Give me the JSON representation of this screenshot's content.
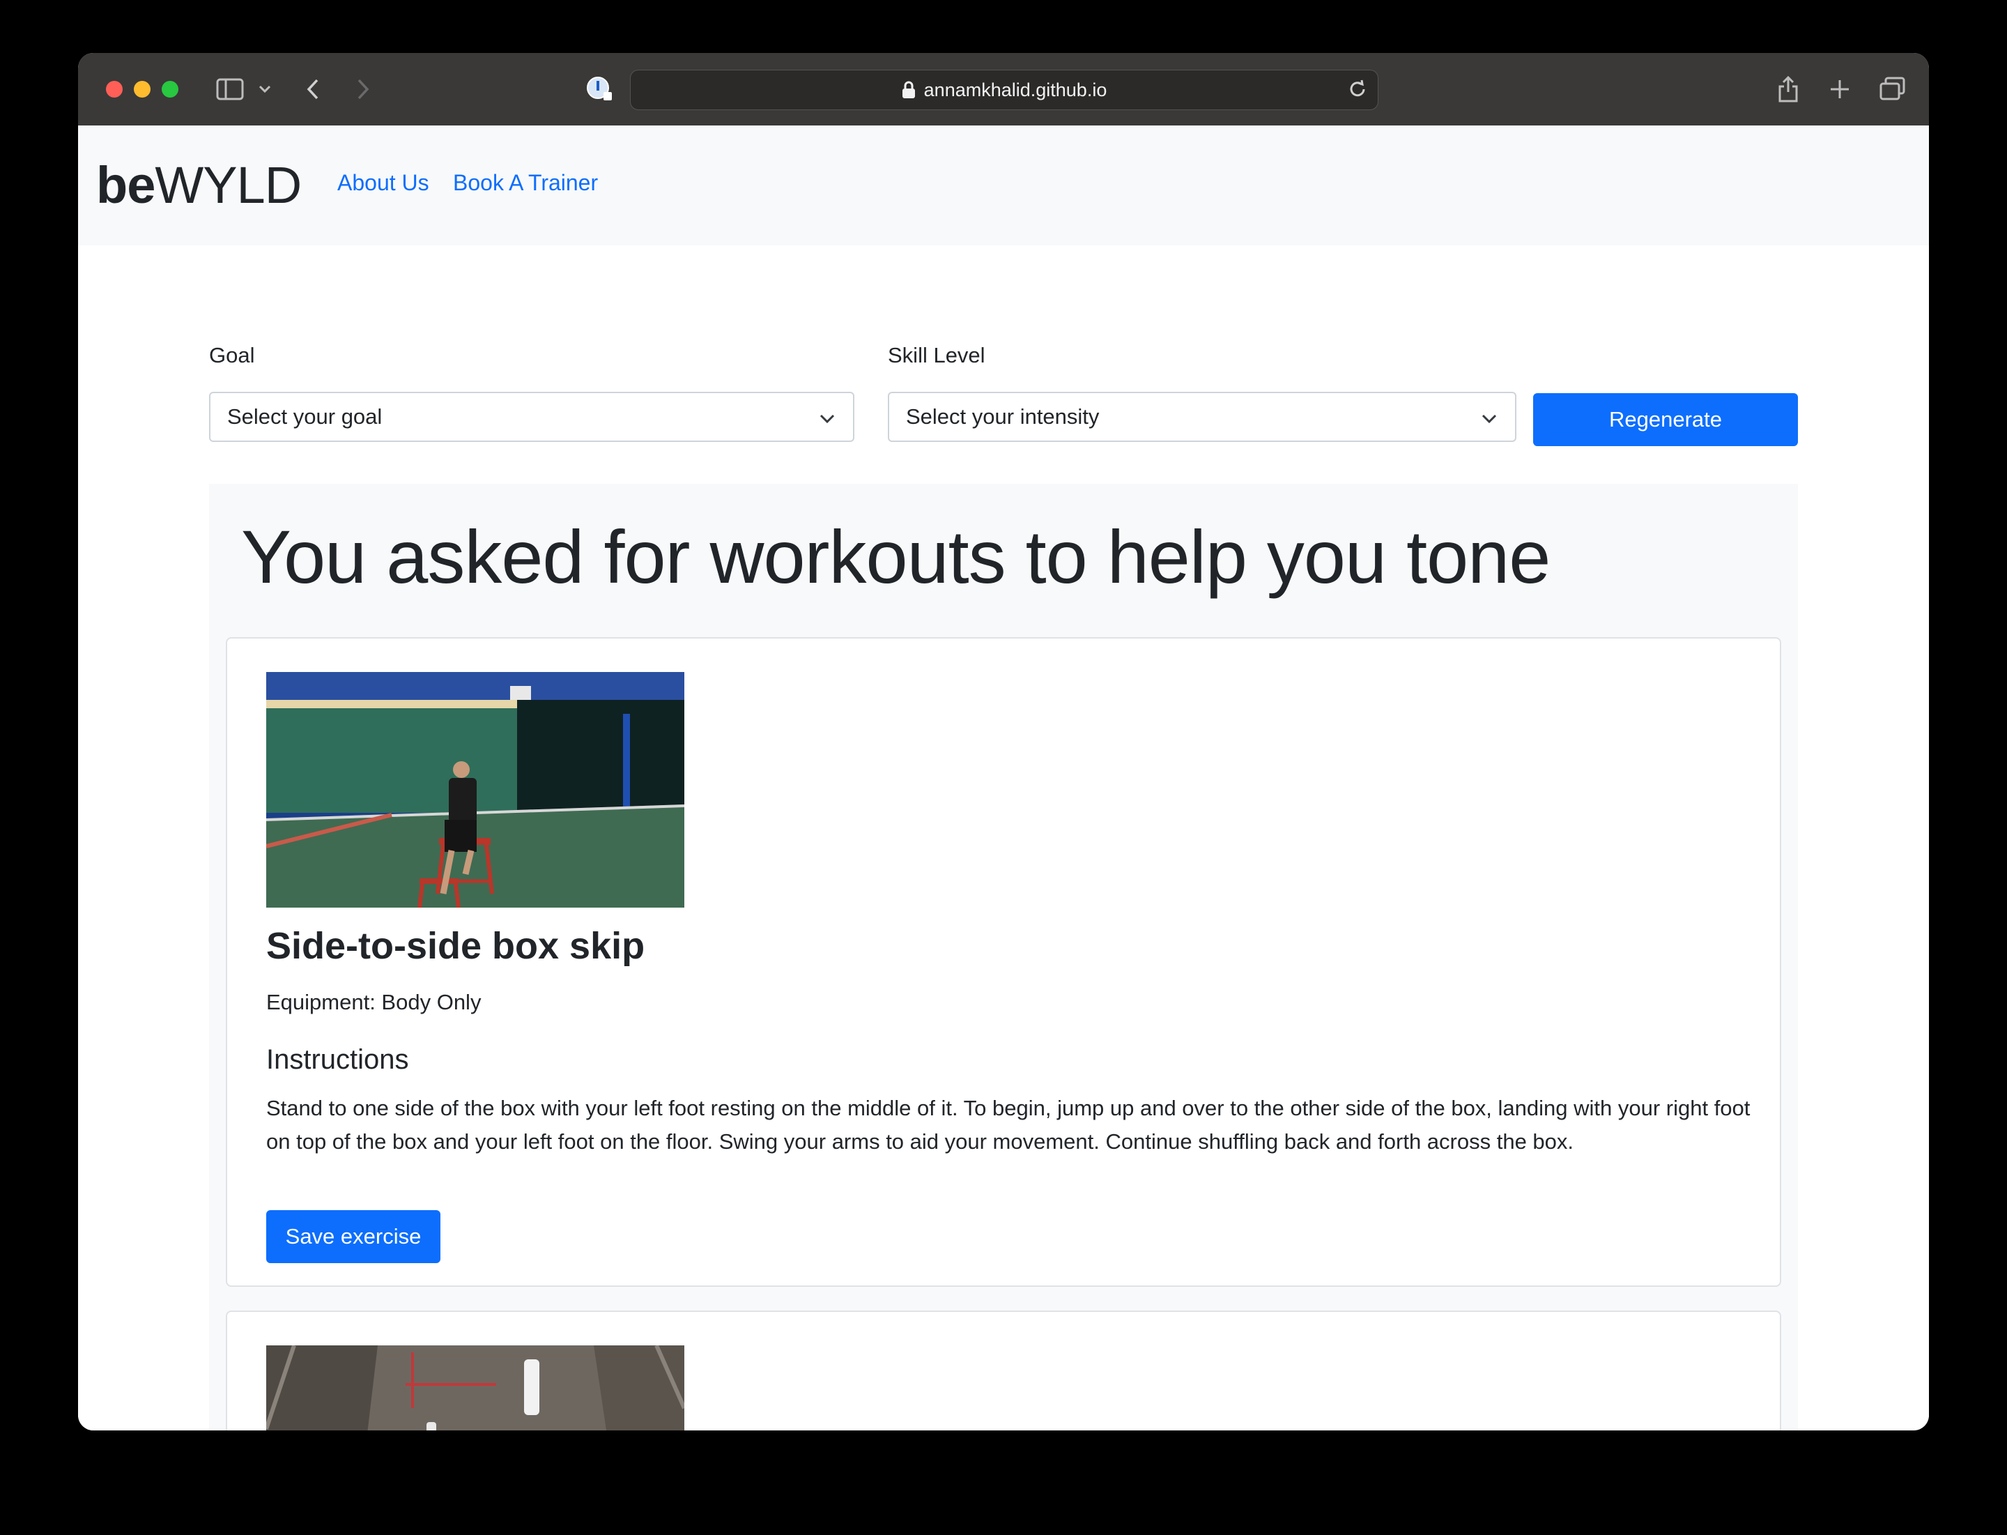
{
  "browser": {
    "url": "annamkhalid.github.io"
  },
  "navbar": {
    "brand_bold": "be",
    "brand_light": "WYLD",
    "links": [
      "About Us",
      "Book A Trainer"
    ]
  },
  "form": {
    "goal_label": "Goal",
    "goal_value": "Select your goal",
    "skill_label": "Skill Level",
    "skill_value": "Select your intensity",
    "regenerate_label": "Regenerate"
  },
  "results": {
    "heading": "You asked for workouts to help you tone",
    "exercises": [
      {
        "title": "Side-to-side box skip",
        "equipment": "Equipment: Body Only",
        "instructions_heading": "Instructions",
        "instructions": "Stand to one side of the box with your left foot resting on the middle of it. To begin, jump up and over to the other side of the box, landing with your right foot on top of the box and your left foot on the floor. Swing your arms to aid your movement. Continue shuffling back and forth across the box.",
        "save_label": "Save exercise"
      }
    ]
  },
  "icons": {
    "sidebar": "sidebar-icon",
    "back": "chevron-left-icon",
    "forward": "chevron-right-icon",
    "privacy": "privacy-report-icon",
    "lock": "lock-icon",
    "reload": "reload-icon",
    "share": "share-icon",
    "new_tab": "plus-icon",
    "tabs": "tab-overview-icon"
  },
  "colors": {
    "primary": "#0d6efd",
    "navbar_bg": "#f8f9fa",
    "text": "#212529"
  }
}
